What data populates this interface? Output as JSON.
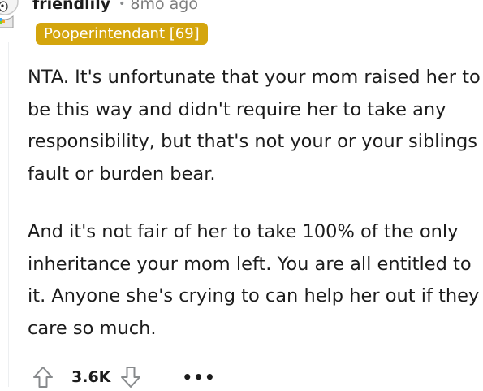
{
  "comment": {
    "author": "friendlily",
    "separator": "•",
    "timestamp": "8mo ago",
    "flair": "Pooperintendant [69]",
    "paragraphs": [
      "NTA. It's unfortunate that your mom raised her to be this way and didn't require her to take any responsibility, but that's not your or your siblings fault or burden bear.",
      "And it's not fair of her to take 100% of the only inheritance your mom left. You are all entitled to it. Anyone she's crying to can help her out if they care so much."
    ],
    "score": "3.6K",
    "more_label": "•••"
  },
  "icons": {
    "avatar": "avatar-icon",
    "upvote": "upvote-arrow-icon",
    "downvote": "downvote-arrow-icon",
    "more": "more-options-icon"
  },
  "colors": {
    "flair_background": "#d4a50d",
    "text": "#1c1c1c",
    "muted": "#7c7c7c"
  }
}
